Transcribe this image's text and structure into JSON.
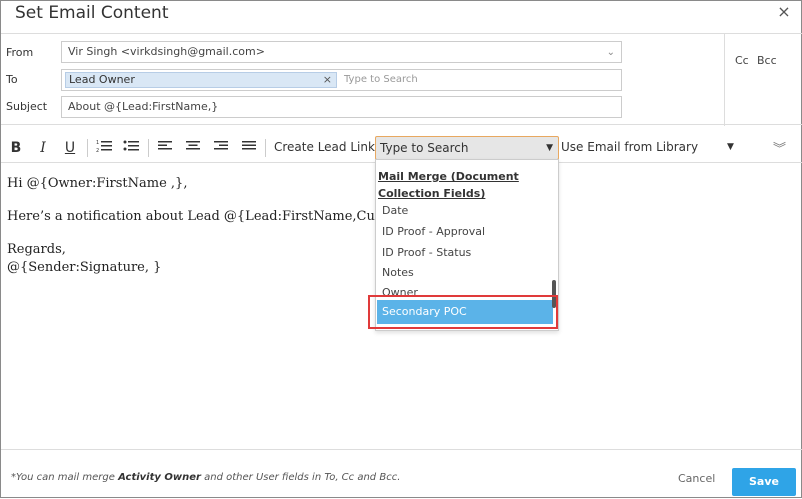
{
  "dialog": {
    "title": "Set Email Content",
    "close_glyph": "×"
  },
  "header": {
    "from_label": "From",
    "from_value": "Vir Singh <virkdsingh@gmail.com>",
    "to_label": "To",
    "to_token": "Lead Owner",
    "to_placeholder": "Type to Search",
    "subject_label": "Subject",
    "subject_value": "About @{Lead:FirstName,}",
    "cc_label": "Cc",
    "bcc_label": "Bcc"
  },
  "toolbar": {
    "bold": "B",
    "italic": "I",
    "underline": "U",
    "create_lead_link": "Create Lead Link",
    "type_to_search": "Type to Search",
    "use_email_from_library": "Use Email from Library"
  },
  "editor": {
    "line1": "Hi @{Owner:FirstName ,},",
    "line2": "Here’s a notification about Lead @{Lead:FirstName,Custome",
    "line3": "Regards,",
    "line4": "@{Sender:Signature, }"
  },
  "dropdown": {
    "group_header": "Mail Merge (Document Collection Fields)",
    "items": [
      "Date",
      "ID Proof - Approval",
      "ID Proof - Status",
      "Notes",
      "Owner"
    ],
    "selected": "Secondary POC"
  },
  "footer": {
    "note_prefix": "*You can mail merge ",
    "note_bold": "Activity Owner",
    "note_suffix": " and other User fields in To, Cc and Bcc.",
    "cancel": "Cancel",
    "save": "Save"
  },
  "colors": {
    "accent": "#2fa4e7",
    "selected_item": "#5bb3e8",
    "highlight": "#e03a3a",
    "token_bg": "#d9e7f5"
  }
}
